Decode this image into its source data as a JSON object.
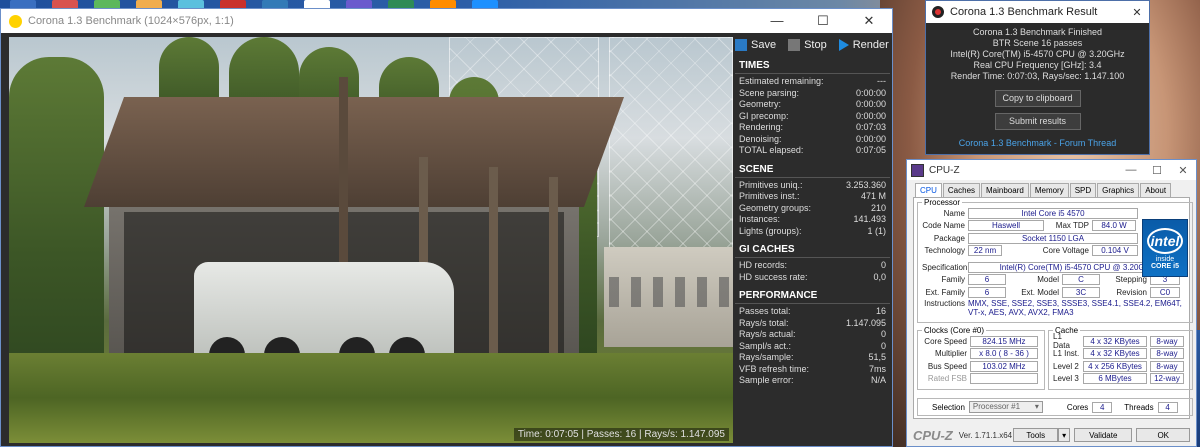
{
  "bench": {
    "title": "Corona 1.3 Benchmark (1024×576px, 1:1)",
    "toolbar": {
      "save": "Save",
      "stop": "Stop",
      "render": "Render"
    },
    "status": "Time: 0:07:05 | Passes: 16 | Rays/s: 1.147.095",
    "sections": [
      {
        "title": "TIMES",
        "rows": [
          {
            "label": "Estimated remaining:",
            "value": "---"
          },
          {
            "label": "Scene parsing:",
            "value": "0:00:00"
          },
          {
            "label": "Geometry:",
            "value": "0:00:00"
          },
          {
            "label": "GI precomp:",
            "value": "0:00:00"
          },
          {
            "label": "Rendering:",
            "value": "0:07:03"
          },
          {
            "label": "Denoising:",
            "value": "0:00:00"
          },
          {
            "label": "TOTAL elapsed:",
            "value": "0:07:05"
          }
        ]
      },
      {
        "title": "SCENE",
        "rows": [
          {
            "label": "Primitives uniq.:",
            "value": "3.253.360"
          },
          {
            "label": "Primitives inst.:",
            "value": "471 M"
          },
          {
            "label": "Geometry groups:",
            "value": "210"
          },
          {
            "label": "Instances:",
            "value": "141.493"
          },
          {
            "label": "Lights (groups):",
            "value": "1 (1)"
          }
        ]
      },
      {
        "title": "GI CACHES",
        "rows": [
          {
            "label": "HD records:",
            "value": "0"
          },
          {
            "label": "HD success rate:",
            "value": "0,0"
          }
        ]
      },
      {
        "title": "PERFORMANCE",
        "rows": [
          {
            "label": "Passes total:",
            "value": "16"
          },
          {
            "label": "Rays/s total:",
            "value": "1.147.095"
          },
          {
            "label": "Rays/s actual:",
            "value": "0"
          },
          {
            "label": "Sampl/s act.:",
            "value": "0"
          },
          {
            "label": "Rays/sample:",
            "value": "51,5"
          },
          {
            "label": "VFB refresh time:",
            "value": "7ms"
          },
          {
            "label": "Sample error:",
            "value": "N/A"
          }
        ]
      }
    ]
  },
  "result": {
    "title": "Corona 1.3 Benchmark Result",
    "lines": [
      "Corona 1.3 Benchmark Finished",
      "BTR Scene 16 passes",
      "Intel(R) Core(TM) i5-4570 CPU @ 3.20GHz",
      "Real CPU Frequency [GHz]: 3.4",
      "Render Time: 0:07:03, Rays/sec: 1.147.100"
    ],
    "copy_button": "Copy to clipboard",
    "submit_button": "Submit results",
    "link": "Corona 1.3 Benchmark - Forum Thread"
  },
  "cpuz": {
    "title": "CPU-Z",
    "tabs": [
      "CPU",
      "Caches",
      "Mainboard",
      "Memory",
      "SPD",
      "Graphics",
      "About"
    ],
    "processor_legend": "Processor",
    "name_label": "Name",
    "name": "Intel Core i5 4570",
    "codename_label": "Code Name",
    "codename": "Haswell",
    "tdp_label": "Max TDP",
    "tdp": "84.0 W",
    "package_label": "Package",
    "package": "Socket 1150 LGA",
    "tech_label": "Technology",
    "tech": "22 nm",
    "voltage_label": "Core Voltage",
    "voltage": "0.104 V",
    "spec_label": "Specification",
    "spec": "Intel(R) Core(TM) i5-4570 CPU @ 3.20GHz",
    "family_label": "Family",
    "family": "6",
    "model_label": "Model",
    "model": "C",
    "stepping_label": "Stepping",
    "stepping": "3",
    "extfamily_label": "Ext. Family",
    "extfamily": "6",
    "extmodel_label": "Ext. Model",
    "extmodel": "3C",
    "revision_label": "Revision",
    "revision": "C0",
    "instr_label": "Instructions",
    "instructions": "MMX, SSE, SSE2, SSE3, SSSE3, SSE4.1, SSE4.2, EM64T, VT-x, AES, AVX, AVX2, FMA3",
    "intel_logo": {
      "brand": "intel",
      "inside": "inside",
      "core": "CORE i5"
    },
    "clocks_legend": "Clocks (Core #0)",
    "corespeed_label": "Core Speed",
    "corespeed": "824.15 MHz",
    "multiplier_label": "Multiplier",
    "multiplier": "x 8.0 ( 8 - 36 )",
    "busspeed_label": "Bus Speed",
    "busspeed": "103.02 MHz",
    "ratedfsb_label": "Rated FSB",
    "ratedfsb": "",
    "cache_legend": "Cache",
    "l1d_label": "L1 Data",
    "l1d": "4 x 32 KBytes",
    "l1d_way": "8-way",
    "l1i_label": "L1 Inst.",
    "l1i": "4 x 32 KBytes",
    "l1i_way": "8-way",
    "l2_label": "Level 2",
    "l2": "4 x 256 KBytes",
    "l2_way": "8-way",
    "l3_label": "Level 3",
    "l3": "6 MBytes",
    "l3_way": "12-way",
    "selection_label": "Selection",
    "selection": "Processor #1",
    "cores_label": "Cores",
    "cores": "4",
    "threads_label": "Threads",
    "threads": "4",
    "brand": "CPU-Z",
    "version": "Ver. 1.71.1.x64",
    "tools_button": "Tools",
    "validate_button": "Validate",
    "ok_button": "OK"
  },
  "colors": {
    "accent": "#4aa3e8",
    "toolbar_save": "#2a7ac4",
    "toolbar_render": "#1e8be0",
    "intel_blue": "#0e71c4"
  }
}
